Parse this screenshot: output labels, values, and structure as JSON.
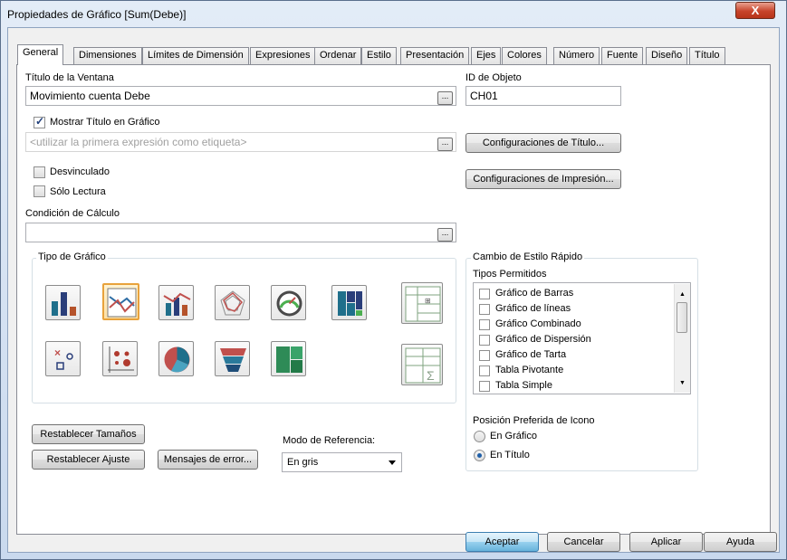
{
  "window": {
    "title": "Propiedades de Gráfico [Sum(Debe)]",
    "close": "X"
  },
  "tabs": [
    "General",
    "Dimensiones",
    "Límites de Dimensión",
    "Expresiones",
    "Ordenar",
    "Estilo",
    "Presentación",
    "Ejes",
    "Colores",
    "Número",
    "Fuente",
    "Diseño",
    "Título"
  ],
  "general": {
    "window_title_label": "Título de la Ventana",
    "window_title_value": "Movimiento cuenta Debe",
    "object_id_label": "ID de Objeto",
    "object_id_value": "CH01",
    "show_title_label": "Mostrar Título en Gráfico",
    "show_title_checked": true,
    "title_placeholder": "<utilizar la primera expresión como etiqueta>",
    "title_settings": "Configuraciones de Título...",
    "print_settings": "Configuraciones de Impresión...",
    "detached_label": "Desvinculado",
    "readonly_label": "Sólo Lectura",
    "calc_condition_label": "Condición de Cálculo",
    "calc_condition_value": "",
    "ellipsis": "..."
  },
  "chart_type": {
    "legend": "Tipo de Gráfico",
    "icons": [
      "bar-chart-icon",
      "line-chart-icon",
      "combo-chart-icon",
      "radar-chart-icon",
      "gauge-chart-icon",
      "mekko-chart-icon",
      "pivot-table-icon",
      "scatter-chart-icon",
      "grid-chart-icon",
      "pie-chart-icon",
      "funnel-chart-icon",
      "block-chart-icon",
      "straight-table-icon"
    ],
    "selected": "line-chart-icon"
  },
  "quick_style": {
    "legend": "Cambio de Estilo Rápido",
    "allowed_label": "Tipos Permitidos",
    "items": [
      "Gráfico de Barras",
      "Gráfico de líneas",
      "Gráfico Combinado",
      "Gráfico de Dispersión",
      "Gráfico de Tarta",
      "Tabla Pivotante",
      "Tabla Simple"
    ],
    "icon_pos_label": "Posición Preferida de Icono",
    "radio_chart": "En Gráfico",
    "radio_title": "En Título",
    "selected_radio": "En Título"
  },
  "bottom": {
    "reset_sizes": "Restablecer Tamaños",
    "reset_fit": "Restablecer Ajuste",
    "error_messages": "Mensajes de error...",
    "ref_mode_label": "Modo de Referencia:",
    "ref_mode_value": "En gris"
  },
  "footer": {
    "ok": "Aceptar",
    "cancel": "Cancelar",
    "apply": "Aplicar",
    "help": "Ayuda"
  },
  "colors": {
    "accent": "#3c7fb1",
    "selected_icon": "#e8a23c",
    "close": "#c7442b"
  }
}
